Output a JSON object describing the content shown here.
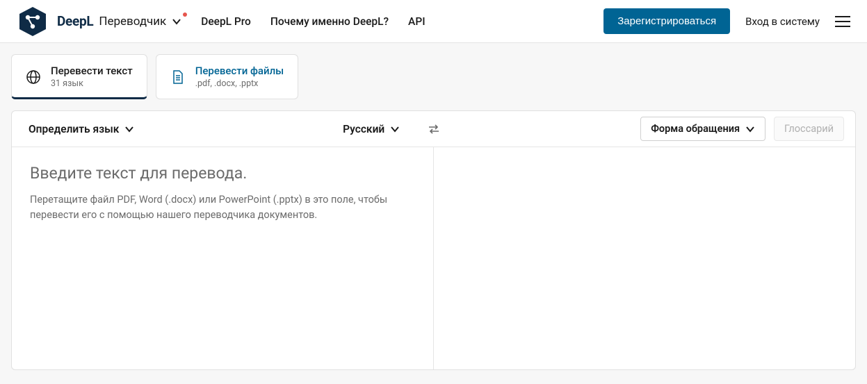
{
  "header": {
    "brand_name": "DeepL",
    "brand_product": "Переводчик",
    "nav": [
      "DeepL Pro",
      "Почему именно DeepL?",
      "API"
    ],
    "signup_label": "Зарегистрироваться",
    "login_label": "Вход в систему"
  },
  "mode_tabs": {
    "text": {
      "title": "Перевести текст",
      "sub": "31 язык"
    },
    "files": {
      "title": "Перевести файлы",
      "sub": ".pdf, .docx, .pptx"
    }
  },
  "translator": {
    "source_lang": "Определить язык",
    "target_lang": "Русский",
    "formality_label": "Форма обращения",
    "glossary_label": "Глоссарий",
    "placeholder_title": "Введите текст для перевода.",
    "placeholder_sub": "Перетащите файл PDF, Word (.docx) или PowerPoint (.pptx) в это поле, чтобы перевести его с помощью нашего переводчика документов."
  }
}
